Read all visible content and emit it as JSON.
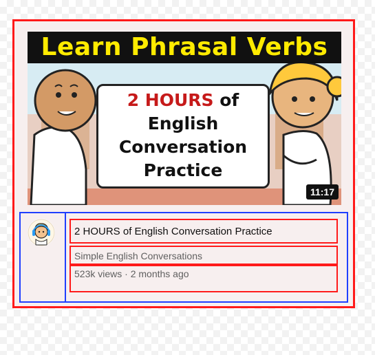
{
  "video": {
    "thumbnail": {
      "banner_text": "Learn Phrasal Verbs",
      "headline_highlight": "2 HOURS",
      "headline_of": "of",
      "headline_line2": "English",
      "headline_line3": "Conversation",
      "headline_line4": "Practice",
      "duration": "11:17",
      "banner_color": "#ffeb00",
      "highlight_color": "#c61a1a"
    },
    "title": "2 HOURS of English Conversation Practice",
    "channel": "Simple English Conversations",
    "stats": "523k views · 2 months ago",
    "avatar_icon": "channel-avatar-icon"
  },
  "annotation_colors": {
    "red_box": "#ff1a1a",
    "blue_box": "#1f3fff"
  }
}
